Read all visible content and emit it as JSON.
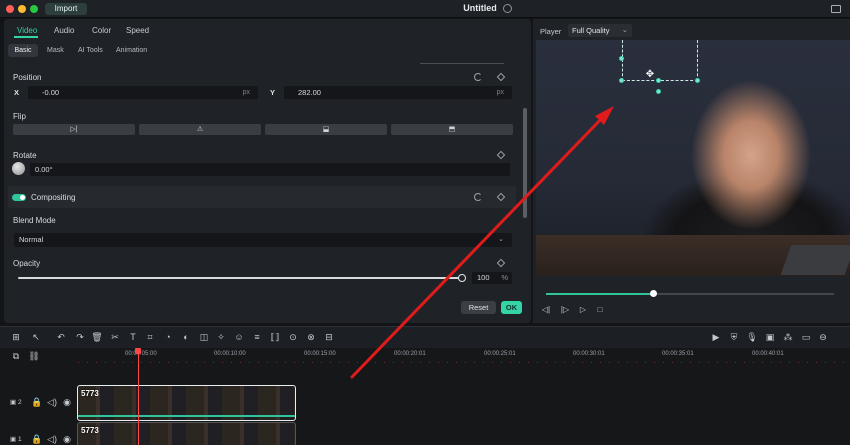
{
  "window": {
    "title": "Untitled",
    "import_label": "Import"
  },
  "colors": {
    "accent": "#35d3a8",
    "playhead": "#ff4545",
    "arrow": "#e01b1b",
    "panel": "#1f2226"
  },
  "props": {
    "tabs": [
      "Video",
      "Audio",
      "Color",
      "Speed"
    ],
    "subtabs": [
      "Basic",
      "Mask",
      "AI Tools",
      "Animation"
    ],
    "position": {
      "label": "Position",
      "x_label": "X",
      "x_value": "-0.00",
      "y_label": "Y",
      "y_value": "282.00",
      "unit": "px"
    },
    "flip": {
      "label": "Flip",
      "buttons": [
        "▷|",
        "⚠",
        "⬓",
        "⬒"
      ]
    },
    "rotate": {
      "label": "Rotate",
      "value": "0.00°"
    },
    "compositing": {
      "label": "Compositing",
      "enabled": true
    },
    "blend": {
      "label": "Blend Mode",
      "value": "Normal"
    },
    "opacity": {
      "label": "Opacity",
      "value": "100",
      "unit": "%",
      "fraction": 1.0
    },
    "reset_label": "Reset",
    "ok_label": "OK"
  },
  "player": {
    "label": "Player",
    "quality": "Full Quality",
    "progress": 0.37
  },
  "timeline": {
    "ticks": [
      "00:00:05:00",
      "00:00:10:00",
      "00:00:15:00",
      "00:00:20:01",
      "00:00:25:01",
      "00:00:30:01",
      "00:00:35:01",
      "00:00:40:01"
    ],
    "tracks": [
      {
        "number": "2",
        "clip_name": "5773"
      },
      {
        "number": "1",
        "clip_name": "5773"
      }
    ]
  }
}
